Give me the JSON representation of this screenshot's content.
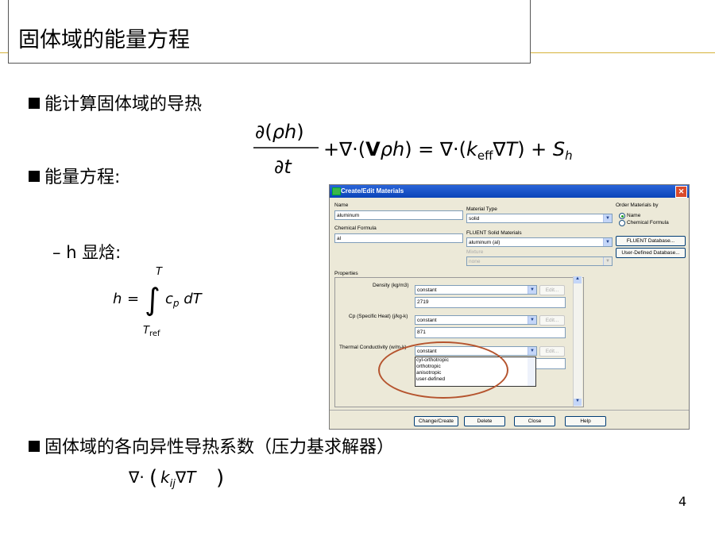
{
  "slide": {
    "title": "固体域的能量方程",
    "bullet1": "能计算固体域的导热",
    "bullet2": "能量方程:",
    "sub_bullet": "h 显焓:",
    "sub_bullet_dash": "–",
    "bullet3": "固体域的各向异性导热系数（压力基求解器）",
    "page_number": "4"
  },
  "dialog": {
    "title": "Create/Edit Materials",
    "close_symbol": "✕",
    "name_label": "Name",
    "name_value": "aluminum",
    "chemical_formula_label": "Chemical Formula",
    "chemical_formula_value": "al",
    "material_type_label": "Material Type",
    "material_type_value": "solid",
    "fluent_solid_materials_label": "FLUENT Solid Materials",
    "fluent_solid_materials_value": "aluminum (al)",
    "mixture_label": "Mixture",
    "mixture_value": "none",
    "order_by_label": "Order Materials by",
    "order_options": [
      "Name",
      "Chemical Formula"
    ],
    "fluent_database_button": "FLUENT Database...",
    "user_defined_database_button": "User-Defined Database...",
    "properties_label": "Properties",
    "density_label": "Density (kg/m3)",
    "density_method": "constant",
    "density_value": "2719",
    "cp_label": "Cp (Specific Heat) (j/kg-k)",
    "cp_method": "constant",
    "cp_value": "871",
    "tc_label": "Thermal Conductivity (w/m-k)",
    "tc_method": "constant",
    "edit_button": "Edit...",
    "tc_options": [
      "cyl-orthotropic",
      "orthotropic",
      "anisotropic",
      "user-defined"
    ],
    "buttons": {
      "change_create": "Change/Create",
      "delete": "Delete",
      "close": "Close",
      "help": "Help"
    },
    "arrow_down": "▼",
    "arrow_up": "▲"
  },
  "colors": {
    "highlight_oval": "#b5542e",
    "title_bar": "#0a44b8",
    "separator_line": "#d6b23a"
  }
}
